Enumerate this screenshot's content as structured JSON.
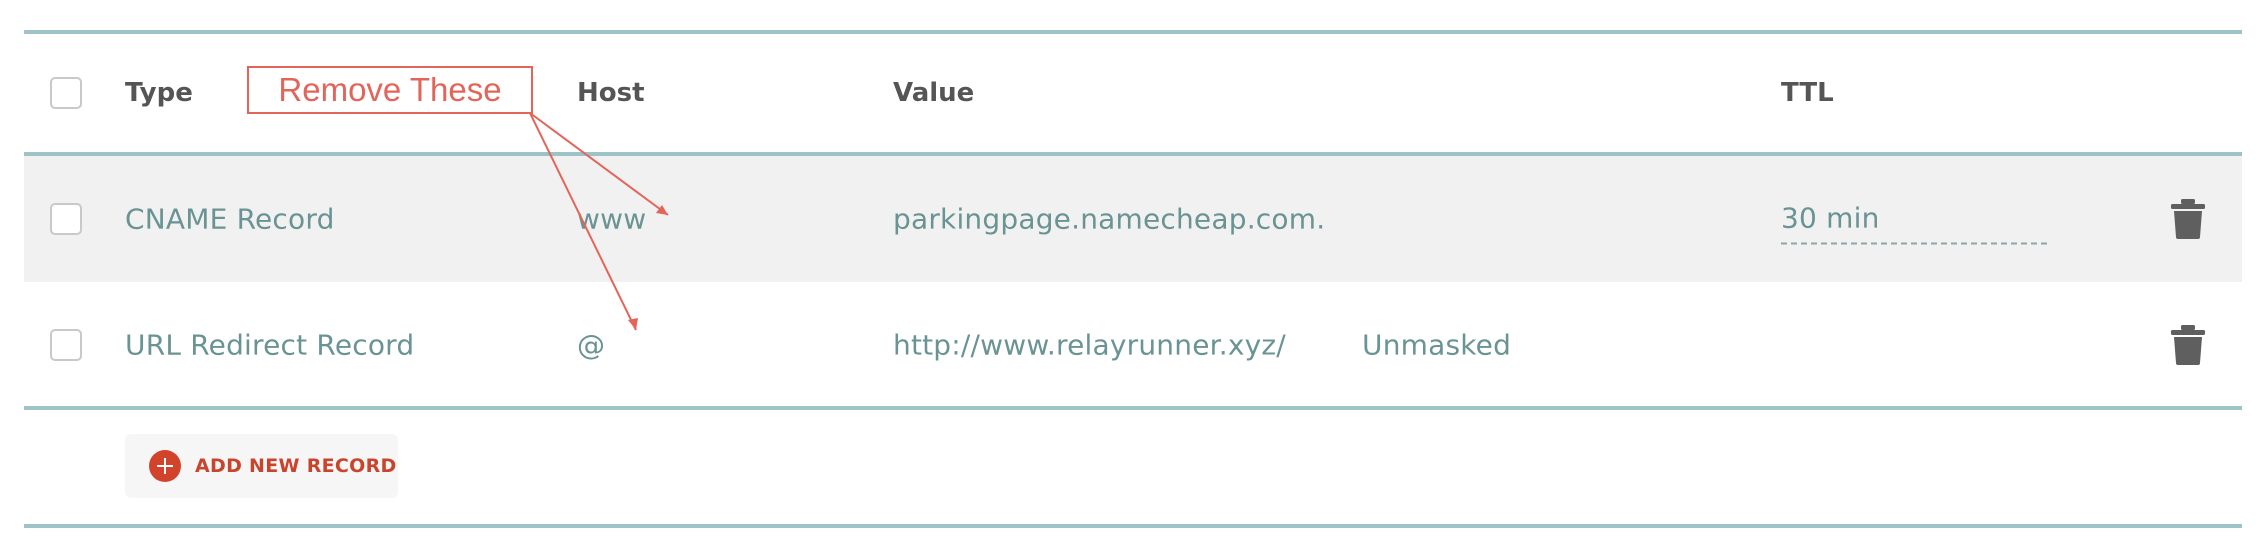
{
  "header": {
    "type": "Type",
    "host": "Host",
    "value": "Value",
    "ttl": "TTL"
  },
  "records": [
    {
      "type": "CNAME Record",
      "host": "www",
      "value": "parkingpage.namecheap.com.",
      "extra": "",
      "ttl": "30 min"
    },
    {
      "type": "URL Redirect Record",
      "host": "@",
      "value": "http://www.relayrunner.xyz/",
      "extra": "Unmasked",
      "ttl": ""
    }
  ],
  "actions": {
    "add_new_record": "ADD NEW RECORD"
  },
  "annotation": {
    "text": "Remove These"
  },
  "icons": {
    "delete": "trash-icon",
    "add": "plus-circle-icon"
  },
  "colors": {
    "divider": "#9dc3c6",
    "record_text": "#6a9393",
    "accent": "#d2432b",
    "annotation": "#e3655a"
  }
}
